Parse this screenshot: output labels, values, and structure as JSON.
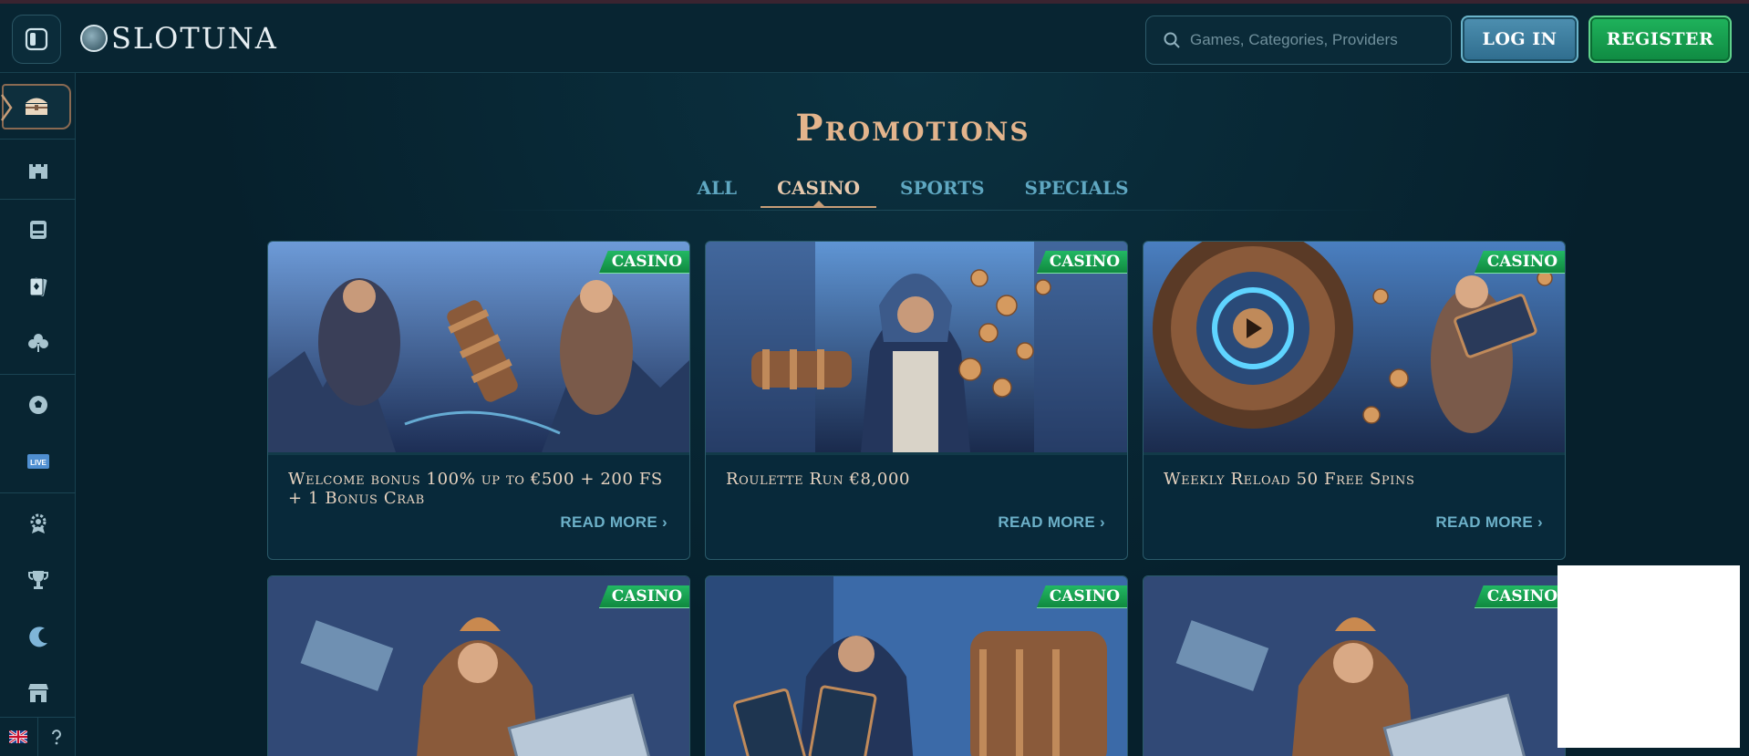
{
  "header": {
    "logo_text": "SLOTUNA",
    "search_placeholder": "Games, Categories, Providers",
    "login_label": "LOG IN",
    "register_label": "REGISTER"
  },
  "sidebar": {
    "items": [
      {
        "icon": "treasure-chest-icon"
      },
      {
        "icon": "castle-icon"
      },
      {
        "icon": "slot-machine-icon"
      },
      {
        "icon": "playing-cards-icon"
      },
      {
        "icon": "clubs-icon"
      },
      {
        "icon": "soccer-ball-icon"
      },
      {
        "icon": "live-icon",
        "label": "LIVE"
      },
      {
        "icon": "gear-badge-icon"
      },
      {
        "icon": "trophy-icon"
      },
      {
        "icon": "moon-icon"
      },
      {
        "icon": "shop-icon"
      }
    ],
    "footer": {
      "language": "flag-uk-icon",
      "help": "help-icon"
    }
  },
  "main": {
    "title": "Promotions",
    "tabs": [
      {
        "label": "ALL",
        "active": false
      },
      {
        "label": "CASINO",
        "active": true
      },
      {
        "label": "SPORTS",
        "active": false
      },
      {
        "label": "SPECIALS",
        "active": false
      }
    ],
    "promotions": [
      {
        "badge": "CASINO",
        "title": "Welcome bonus 100% up to €500 + 200 FS + 1 Bonus Crab",
        "cta": "READ MORE ›"
      },
      {
        "badge": "CASINO",
        "title": "Roulette Run €8,000",
        "cta": "READ MORE ›"
      },
      {
        "badge": "CASINO",
        "title": "Weekly Reload 50 Free Spins",
        "cta": "READ MORE ›"
      },
      {
        "badge": "CASINO"
      },
      {
        "badge": "CASINO"
      },
      {
        "badge": "CASINO"
      }
    ]
  },
  "colors": {
    "background": "#06202c",
    "title_gold": "#e3b48c",
    "tab_blue": "#5fa7c1",
    "badge_green": "#1aa653",
    "login_blue": "#3f7fa1",
    "register_green": "#17a04f"
  }
}
